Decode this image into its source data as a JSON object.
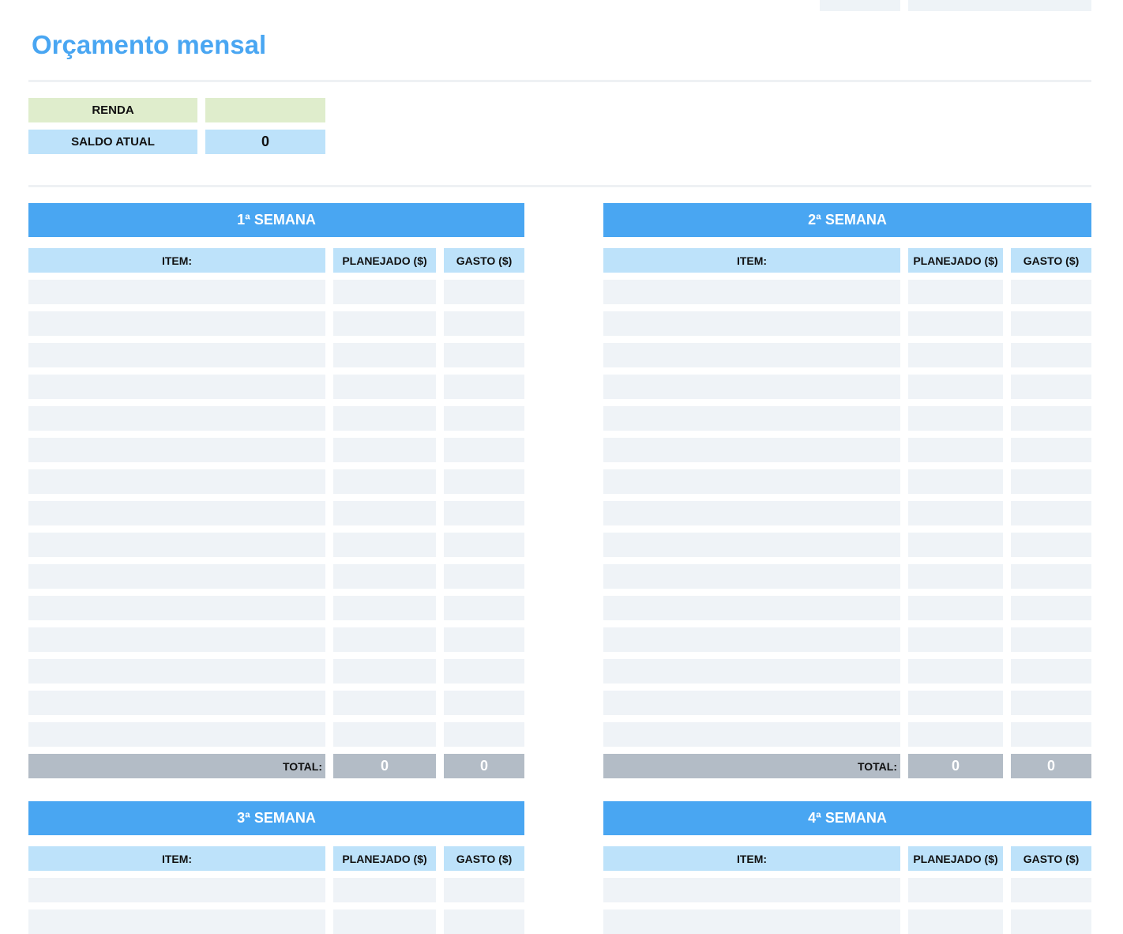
{
  "title": "Orçamento mensal",
  "summary": {
    "income_label": "RENDA",
    "income_value": "",
    "balance_label": "SALDO ATUAL",
    "balance_value": "0"
  },
  "columns": {
    "item": "ITEM:",
    "planned": "PLANEJADO ($)",
    "spent": "GASTO ($)"
  },
  "total_label": "TOTAL:",
  "weeks": [
    {
      "title": "1ª SEMANA",
      "total_planned": "0",
      "total_spent": "0"
    },
    {
      "title": "2ª SEMANA",
      "total_planned": "0",
      "total_spent": "0"
    },
    {
      "title": "3ª SEMANA"
    },
    {
      "title": "4ª SEMANA"
    }
  ],
  "colors": {
    "accent": "#49a6f2",
    "header_light": "#bde2fa",
    "income_green": "#dfedcc",
    "row_fill": "#eff3f7",
    "total_gray": "#b3bcc6"
  }
}
